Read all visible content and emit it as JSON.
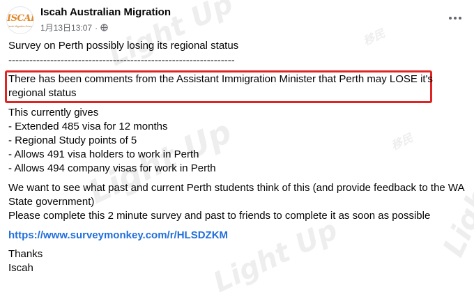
{
  "header": {
    "page_name": "Iscah Australian Migration",
    "timestamp": "1月13日13:07",
    "separator": "·",
    "privacy_icon": "globe-icon",
    "more_icon": "more-options-icon",
    "avatar_logo_text": "ISCAH",
    "avatar_logo_sub": "Iscah Migration Group"
  },
  "post": {
    "title": "Survey on Perth possibly losing its regional status",
    "divider": "-----------------------------------------------------------------",
    "highlight_line_1": "There has been comments from the Assistant Immigration Minister that Perth may LOSE it's",
    "highlight_line_2": "regional status",
    "highlight_color": "#e02424",
    "gives_intro": "This currently gives",
    "benefits": [
      "- Extended 485 visa for 12 months",
      "- Regional Study points of 5",
      "- Allows 491 visa holders to work in Perth",
      "- Allows 494 company visas for work in Perth"
    ],
    "request_line_1": "We want to see what past and current Perth students think of this (and provide feedback to the WA",
    "request_line_2": "State government)",
    "request_line_3": "Please complete this 2 minute survey and past to friends to complete it as soon as possible",
    "survey_link": "https://www.surveymonkey.com/r/HLSDZKM",
    "link_color": "#216fdb",
    "sign_off_1": "Thanks",
    "sign_off_2": "Iscah"
  },
  "watermark": {
    "text": "Light Up",
    "sub": "移民"
  }
}
